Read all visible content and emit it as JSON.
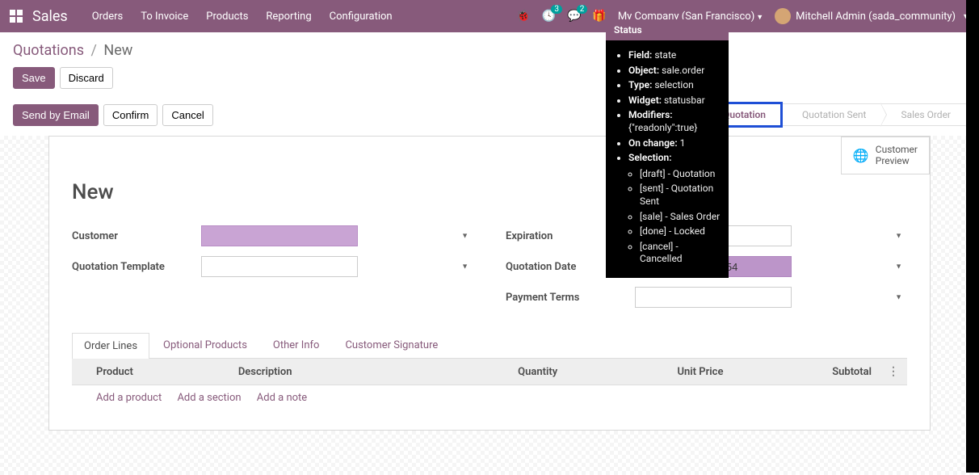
{
  "topbar": {
    "app_title": "Sales",
    "menu": [
      "Orders",
      "To Invoice",
      "Products",
      "Reporting",
      "Configuration"
    ],
    "activities_badge": "3",
    "discuss_badge": "2",
    "company": "My Company (San Francisco)",
    "user": "Mitchell Admin (sada_community)"
  },
  "breadcrumb": {
    "module": "Quotations",
    "current": "New"
  },
  "buttons": {
    "save": "Save",
    "discard": "Discard",
    "send_email": "Send by Email",
    "confirm": "Confirm",
    "cancel": "Cancel"
  },
  "statusbar": {
    "steps": [
      "Quotation",
      "Quotation Sent",
      "Sales Order"
    ]
  },
  "customer_preview": {
    "line1": "Customer",
    "line2": "Preview"
  },
  "form": {
    "title": "New",
    "fields": {
      "customer": "Customer",
      "quotation_template": "Quotation Template",
      "expiration": "Expiration",
      "quotation_date": "Quotation Date",
      "payment_terms": "Payment Terms"
    },
    "values": {
      "customer": "",
      "quotation_template": "",
      "expiration": "",
      "quotation_date": "08/11/2020 14:47:54",
      "payment_terms": ""
    }
  },
  "tabs": [
    "Order Lines",
    "Optional Products",
    "Other Info",
    "Customer Signature"
  ],
  "table": {
    "headers": {
      "product": "Product",
      "description": "Description",
      "quantity": "Quantity",
      "unit_price": "Unit Price",
      "subtotal": "Subtotal"
    },
    "add_product": "Add a product",
    "add_section": "Add a section",
    "add_note": "Add a note"
  },
  "tooltip": {
    "title": "Status",
    "rows": [
      {
        "k": "Field:",
        "v": "state"
      },
      {
        "k": "Object:",
        "v": "sale.order"
      },
      {
        "k": "Type:",
        "v": "selection"
      },
      {
        "k": "Widget:",
        "v": "statusbar"
      },
      {
        "k": "Modifiers:",
        "v": "{\"readonly\":true}"
      },
      {
        "k": "On change:",
        "v": "1"
      },
      {
        "k": "Selection:",
        "v": ""
      }
    ],
    "selection": [
      "[draft] - Quotation",
      "[sent] - Quotation Sent",
      "[sale] - Sales Order",
      "[done] - Locked",
      "[cancel] - Cancelled"
    ]
  }
}
